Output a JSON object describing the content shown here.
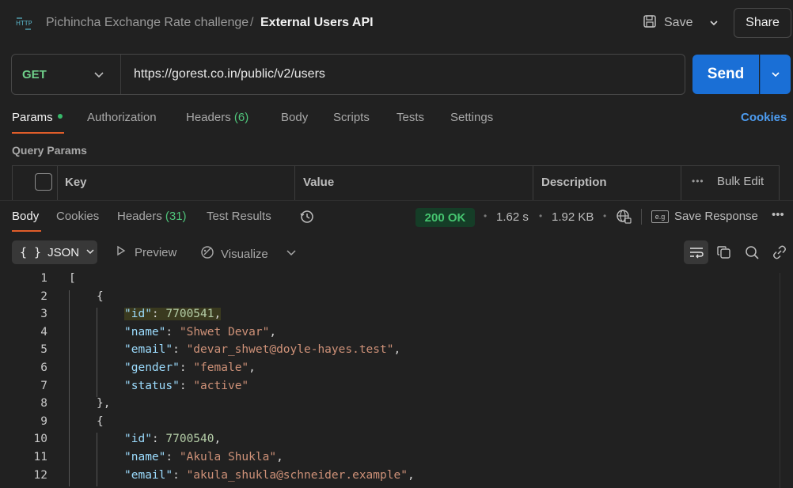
{
  "header": {
    "collection": "Pichincha Exchange Rate challenge",
    "separator": "/",
    "title": "External Users API",
    "save_label": "Save",
    "share_label": "Share"
  },
  "request": {
    "method": "GET",
    "url": "https://gorest.co.in/public/v2/users",
    "send_label": "Send"
  },
  "request_tabs": {
    "params": "Params",
    "authorization": "Authorization",
    "headers": "Headers",
    "headers_count": "(6)",
    "body": "Body",
    "scripts": "Scripts",
    "tests": "Tests",
    "settings": "Settings",
    "cookies": "Cookies"
  },
  "query_params": {
    "label": "Query Params",
    "col_key": "Key",
    "col_value": "Value",
    "col_description": "Description",
    "bulk_edit": "Bulk Edit"
  },
  "response_tabs": {
    "body": "Body",
    "cookies": "Cookies",
    "headers": "Headers",
    "headers_count": "(31)",
    "test_results": "Test Results"
  },
  "response_meta": {
    "status": "200 OK",
    "time": "1.62 s",
    "size": "1.92 KB",
    "save_response": "Save Response",
    "save_icon_text": "e.g"
  },
  "format_bar": {
    "format": "JSON",
    "preview": "Preview",
    "visualize": "Visualize"
  },
  "code_lines": [
    {
      "n": "1",
      "indent": 0,
      "parts": [
        [
          "punct",
          "["
        ]
      ]
    },
    {
      "n": "2",
      "indent": 1,
      "parts": [
        [
          "punct",
          "{"
        ]
      ]
    },
    {
      "n": "3",
      "indent": 2,
      "hl": true,
      "parts": [
        [
          "key",
          "\"id\""
        ],
        [
          "punct",
          ": "
        ],
        [
          "num",
          "7700541"
        ],
        [
          "punct",
          ","
        ]
      ]
    },
    {
      "n": "4",
      "indent": 2,
      "parts": [
        [
          "key",
          "\"name\""
        ],
        [
          "punct",
          ": "
        ],
        [
          "str",
          "\"Shwet Devar\""
        ],
        [
          "punct",
          ","
        ]
      ]
    },
    {
      "n": "5",
      "indent": 2,
      "parts": [
        [
          "key",
          "\"email\""
        ],
        [
          "punct",
          ": "
        ],
        [
          "str",
          "\"devar_shwet@doyle-hayes.test\""
        ],
        [
          "punct",
          ","
        ]
      ]
    },
    {
      "n": "6",
      "indent": 2,
      "parts": [
        [
          "key",
          "\"gender\""
        ],
        [
          "punct",
          ": "
        ],
        [
          "str",
          "\"female\""
        ],
        [
          "punct",
          ","
        ]
      ]
    },
    {
      "n": "7",
      "indent": 2,
      "parts": [
        [
          "key",
          "\"status\""
        ],
        [
          "punct",
          ": "
        ],
        [
          "str",
          "\"active\""
        ]
      ]
    },
    {
      "n": "8",
      "indent": 1,
      "parts": [
        [
          "punct",
          "},"
        ]
      ]
    },
    {
      "n": "9",
      "indent": 1,
      "parts": [
        [
          "punct",
          "{"
        ]
      ]
    },
    {
      "n": "10",
      "indent": 2,
      "parts": [
        [
          "key",
          "\"id\""
        ],
        [
          "punct",
          ": "
        ],
        [
          "num",
          "7700540"
        ],
        [
          "punct",
          ","
        ]
      ]
    },
    {
      "n": "11",
      "indent": 2,
      "parts": [
        [
          "key",
          "\"name\""
        ],
        [
          "punct",
          ": "
        ],
        [
          "str",
          "\"Akula Shukla\""
        ],
        [
          "punct",
          ","
        ]
      ]
    },
    {
      "n": "12",
      "indent": 2,
      "parts": [
        [
          "key",
          "\"email\""
        ],
        [
          "punct",
          ": "
        ],
        [
          "str",
          "\"akula_shukla@schneider.example\""
        ],
        [
          "punct",
          ","
        ]
      ]
    }
  ]
}
